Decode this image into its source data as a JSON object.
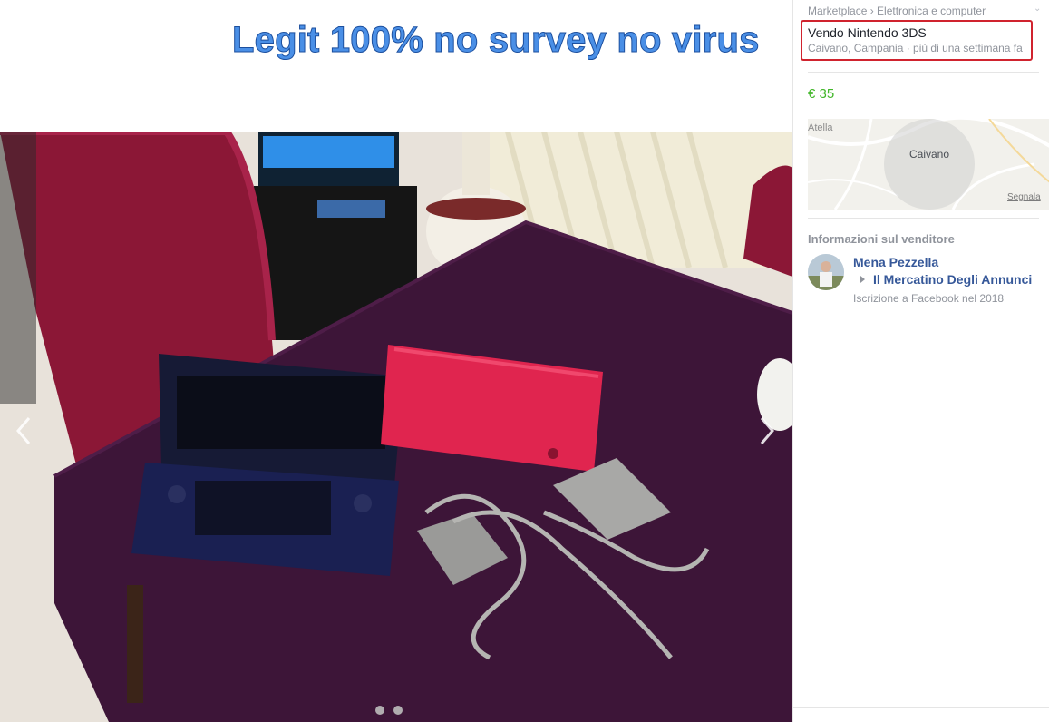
{
  "overlay": {
    "text": "Legit 100% no survey no virus"
  },
  "breadcrumb": {
    "root": "Marketplace",
    "separator": " › ",
    "category": "Elettronica e computer"
  },
  "listing": {
    "title": "Vendo Nintendo 3DS",
    "location_time": "Caivano, Campania · più di una settimana fa",
    "price": "€ 35"
  },
  "map": {
    "place_label": "Caivano",
    "nearby_label": "Atella",
    "report_link": "Segnala"
  },
  "seller": {
    "section_title": "Informazioni sul venditore",
    "name": "Mena Pezzella",
    "group": "Il Mercatino Degli Annunci",
    "joined": "Iscrizione a Facebook nel 2018"
  },
  "carousel": {
    "photo_count": 2,
    "current_index": 1
  },
  "icons": {
    "prev": "chevron-left-icon",
    "next": "chevron-right-icon",
    "breadcrumb_menu": "chevron-down-icon"
  },
  "colors": {
    "price": "#42b72a",
    "link": "#365899",
    "highlight_border": "#d0232e",
    "overlay_text": "#4a8fe6"
  }
}
